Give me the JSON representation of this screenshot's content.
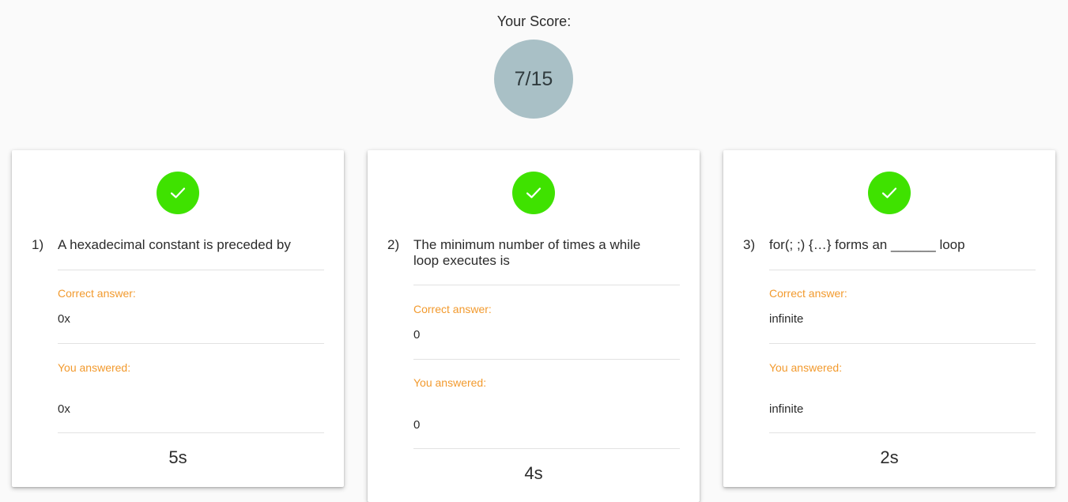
{
  "score": {
    "label": "Your Score:",
    "value": "7/15"
  },
  "colors": {
    "correct_green": "#3fe200",
    "label_orange": "#f29a2e",
    "score_circle": "#a9c0c6"
  },
  "icons": {
    "status": "check-icon"
  },
  "questions": [
    {
      "number": "1)",
      "text": "A hexadecimal constant is preceded by",
      "correct_label": "Correct answer:",
      "correct_value": "0x",
      "answered_label": "You answered:",
      "answered_value": "0x",
      "time": "5s"
    },
    {
      "number": "2)",
      "text": "The minimum number of times a while loop executes is",
      "correct_label": "Correct answer:",
      "correct_value": "0",
      "answered_label": "You answered:",
      "answered_value": "0",
      "time": "4s"
    },
    {
      "number": "3)",
      "text": "for(; ;) {…} forms an ______ loop",
      "correct_label": "Correct answer:",
      "correct_value": "infinite",
      "answered_label": "You answered:",
      "answered_value": "infinite",
      "time": "2s"
    }
  ]
}
